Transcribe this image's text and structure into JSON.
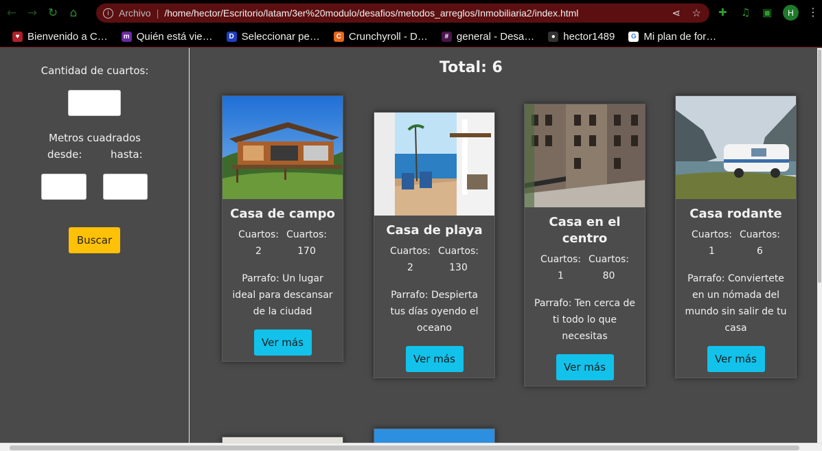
{
  "browser": {
    "archivo_label": "Archivo",
    "url": "/home/hector/Escritorio/latam/3er%20modulo/desafios/metodos_arreglos/Inmobiliaria2/index.html",
    "avatar_letter": "H",
    "bookmarks": [
      {
        "label": "Bienvenido a C…",
        "color": "#b0202a",
        "glyph": "♥"
      },
      {
        "label": "Quién está vie…",
        "color": "#6a2aa0",
        "glyph": "m"
      },
      {
        "label": "Seleccionar pe…",
        "color": "#1f3fbf",
        "glyph": "D"
      },
      {
        "label": "Crunchyroll - D…",
        "color": "#e8661a",
        "glyph": "C"
      },
      {
        "label": "general - Desa…",
        "color": "#4a154b",
        "glyph": "#"
      },
      {
        "label": "hector1489",
        "color": "#333333",
        "glyph": "●"
      },
      {
        "label": "Mi plan de for…",
        "color": "#ffffff",
        "glyph": "G"
      }
    ]
  },
  "sidebar": {
    "rooms_label": "Cantidad de cuartos:",
    "meters_label": "Metros cuadrados",
    "from_label": "desde:",
    "to_label": "hasta:",
    "search_button": "Buscar"
  },
  "total_text": "Total: 6",
  "cards": [
    {
      "title": "Casa de campo",
      "rooms_label_a": "Cuartos:",
      "rooms_value_a": "2",
      "rooms_label_b": "Cuartos:",
      "rooms_value_b": "170",
      "description": "Parrafo: Un lugar ideal para descansar de la ciudad",
      "button": "Ver más"
    },
    {
      "title": "Casa de playa",
      "rooms_label_a": "Cuartos:",
      "rooms_value_a": "2",
      "rooms_label_b": "Cuartos:",
      "rooms_value_b": "130",
      "description": "Parrafo: Despierta tus días oyendo el oceano",
      "button": "Ver más"
    },
    {
      "title": "Casa en el centro",
      "rooms_label_a": "Cuartos:",
      "rooms_value_a": "1",
      "rooms_label_b": "Cuartos:",
      "rooms_value_b": "80",
      "description": "Parrafo: Ten cerca de ti todo lo que necesitas",
      "button": "Ver más"
    },
    {
      "title": "Casa rodante",
      "rooms_label_a": "Cuartos:",
      "rooms_value_a": "1",
      "rooms_label_b": "Cuartos:",
      "rooms_value_b": "6",
      "description": "Parrafo: Conviertete en un nómada del mundo sin salir de tu casa",
      "button": "Ver más"
    }
  ]
}
